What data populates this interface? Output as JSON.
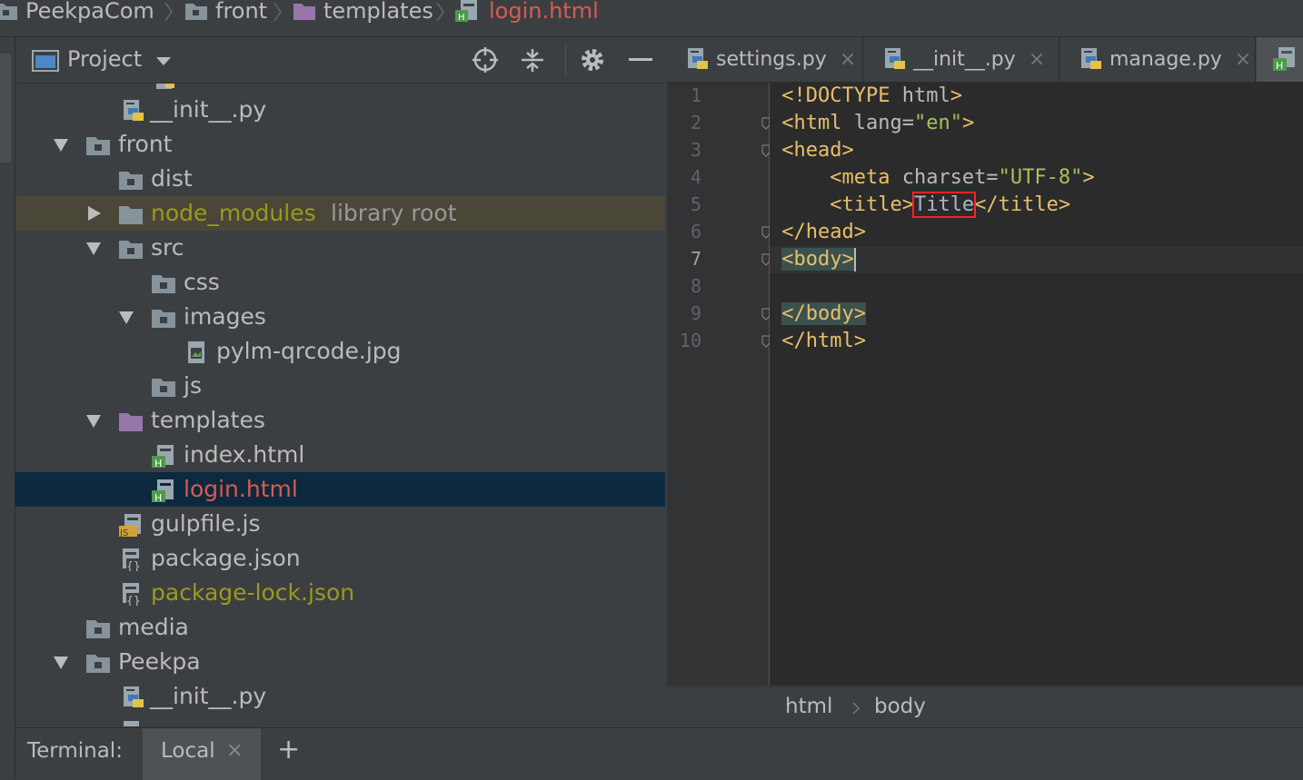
{
  "navbar": {
    "crumbs": [
      {
        "label": "PeekpaCom",
        "icon": "folder-icon"
      },
      {
        "label": "front",
        "icon": "folder-icon"
      },
      {
        "label": "templates",
        "icon": "template-folder-icon"
      },
      {
        "label": "login.html",
        "icon": "html-file-icon"
      }
    ]
  },
  "project": {
    "title": "Project",
    "tree": [
      {
        "label": "__init__.py",
        "icon": "python-file-icon",
        "depth": 3
      },
      {
        "label": "front",
        "icon": "folder-icon",
        "depth": 2,
        "expanded": true
      },
      {
        "label": "dist",
        "icon": "folder-icon",
        "depth": 3
      },
      {
        "label": "node_modules",
        "extra": "library root",
        "icon": "folder-icon",
        "depth": 3,
        "collapsed": true
      },
      {
        "label": "src",
        "icon": "folder-icon",
        "depth": 3,
        "expanded": true
      },
      {
        "label": "css",
        "icon": "folder-icon",
        "depth": 4
      },
      {
        "label": "images",
        "icon": "folder-icon",
        "depth": 4,
        "expanded": true
      },
      {
        "label": "pylm-qrcode.jpg",
        "icon": "image-file-icon",
        "depth": 5
      },
      {
        "label": "js",
        "icon": "folder-icon",
        "depth": 4
      },
      {
        "label": "templates",
        "icon": "template-folder-icon",
        "depth": 3,
        "expanded": true
      },
      {
        "label": "index.html",
        "icon": "html-file-icon",
        "depth": 4
      },
      {
        "label": "login.html",
        "icon": "html-file-icon",
        "depth": 4,
        "selected": true
      },
      {
        "label": "gulpfile.js",
        "icon": "js-file-icon",
        "depth": 3
      },
      {
        "label": "package.json",
        "icon": "json-file-icon",
        "depth": 3
      },
      {
        "label": "package-lock.json",
        "icon": "json-file-icon",
        "depth": 3
      },
      {
        "label": "media",
        "icon": "folder-icon",
        "depth": 2
      },
      {
        "label": "Peekpa",
        "icon": "folder-icon",
        "depth": 2,
        "expanded": true
      },
      {
        "label": "__init__.py",
        "icon": "python-file-icon",
        "depth": 3
      }
    ]
  },
  "editor": {
    "tabs": [
      {
        "label": "settings.py",
        "icon": "python-file-icon",
        "close": "×"
      },
      {
        "label": "__init__.py",
        "icon": "python-file-icon",
        "close": "×"
      },
      {
        "label": "manage.py",
        "icon": "python-file-icon",
        "close": "×"
      }
    ],
    "current_line": 7,
    "lines": [
      [
        {
          "t": "tag",
          "v": "<!DOCTYPE "
        },
        {
          "t": "attr",
          "v": "html"
        },
        {
          "t": "tag",
          "v": ">"
        }
      ],
      [
        {
          "t": "tag",
          "v": "<html "
        },
        {
          "t": "attr",
          "v": "lang="
        },
        {
          "t": "val",
          "v": "\"en\""
        },
        {
          "t": "tag",
          "v": ">"
        }
      ],
      [
        {
          "t": "tag",
          "v": "<head>"
        }
      ],
      [
        {
          "t": "tag",
          "v": "    <meta "
        },
        {
          "t": "attr",
          "v": "charset="
        },
        {
          "t": "val",
          "v": "\"UTF-8\""
        },
        {
          "t": "tag",
          "v": ">"
        }
      ],
      [
        {
          "t": "tag",
          "v": "    <title>"
        },
        {
          "t": "txt",
          "v": "Title",
          "boxed": true
        },
        {
          "t": "tag",
          "v": "</title>"
        }
      ],
      [
        {
          "t": "tag",
          "v": "</head>"
        }
      ],
      [
        {
          "t": "tag",
          "v": "<body>",
          "matched": true
        }
      ],
      [],
      [
        {
          "t": "tag",
          "v": "</body>",
          "matched": true
        }
      ],
      [
        {
          "t": "tag",
          "v": "</html>"
        }
      ]
    ],
    "breadcrumb": [
      "html",
      "body"
    ]
  },
  "bottom": {
    "terminal_label": "Terminal:",
    "session_label": "Local",
    "close": "×",
    "add": "+"
  }
}
